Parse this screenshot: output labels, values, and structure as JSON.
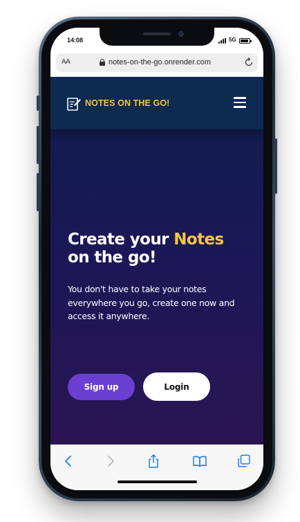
{
  "status_bar": {
    "time": "14:08",
    "network": "5G"
  },
  "browser": {
    "text_size_label": "AA",
    "url": "notes-on-the-go.onrender.com"
  },
  "site": {
    "brand_name": "NOTES ON THE GO!",
    "hero": {
      "title_part1": "Create your ",
      "title_accent": "Notes",
      "title_part2": "on the go!",
      "description": "You don't have to take your notes everywhere you go, create one now and access it anywhere."
    },
    "buttons": {
      "signup": "Sign up",
      "login": "Login"
    }
  },
  "colors": {
    "accent": "#f5c544",
    "primary": "#6b3fd2",
    "navbar": "#0d2a50",
    "safari_blue": "#1a7cf5"
  },
  "icons": {
    "brand": "notepad-pencil-icon",
    "menu": "hamburger-menu-icon",
    "toolbar": [
      "back-icon",
      "forward-icon",
      "share-icon",
      "bookmarks-icon",
      "tabs-icon"
    ]
  }
}
